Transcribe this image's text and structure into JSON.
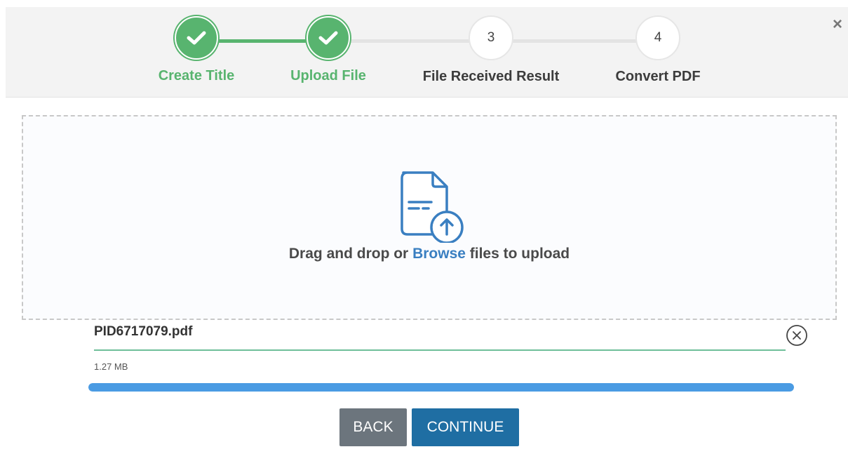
{
  "header": {
    "close_symbol": "×",
    "steps": [
      {
        "number": "1",
        "label": "Create Title",
        "state": "done"
      },
      {
        "number": "2",
        "label": "Upload File",
        "state": "done"
      },
      {
        "number": "3",
        "label": "File Received Result",
        "state": "pending"
      },
      {
        "number": "4",
        "label": "Convert PDF",
        "state": "pending"
      }
    ]
  },
  "dropzone": {
    "text_before": "Drag and drop or ",
    "browse_link": "Browse",
    "text_after": " files to upload",
    "icon": "file-upload-icon"
  },
  "file": {
    "name": "PID6717079.pdf",
    "size": "1.27 MB",
    "progress_percent": 100,
    "remove_icon": "circle-x-icon"
  },
  "actions": {
    "back_label": "BACK",
    "continue_label": "CONTINUE"
  },
  "colors": {
    "step_done": "#58b46f",
    "link": "#3a7fc1",
    "progress": "#4a9be3",
    "back_button": "#6c757d",
    "continue_button": "#1f6ea3"
  }
}
